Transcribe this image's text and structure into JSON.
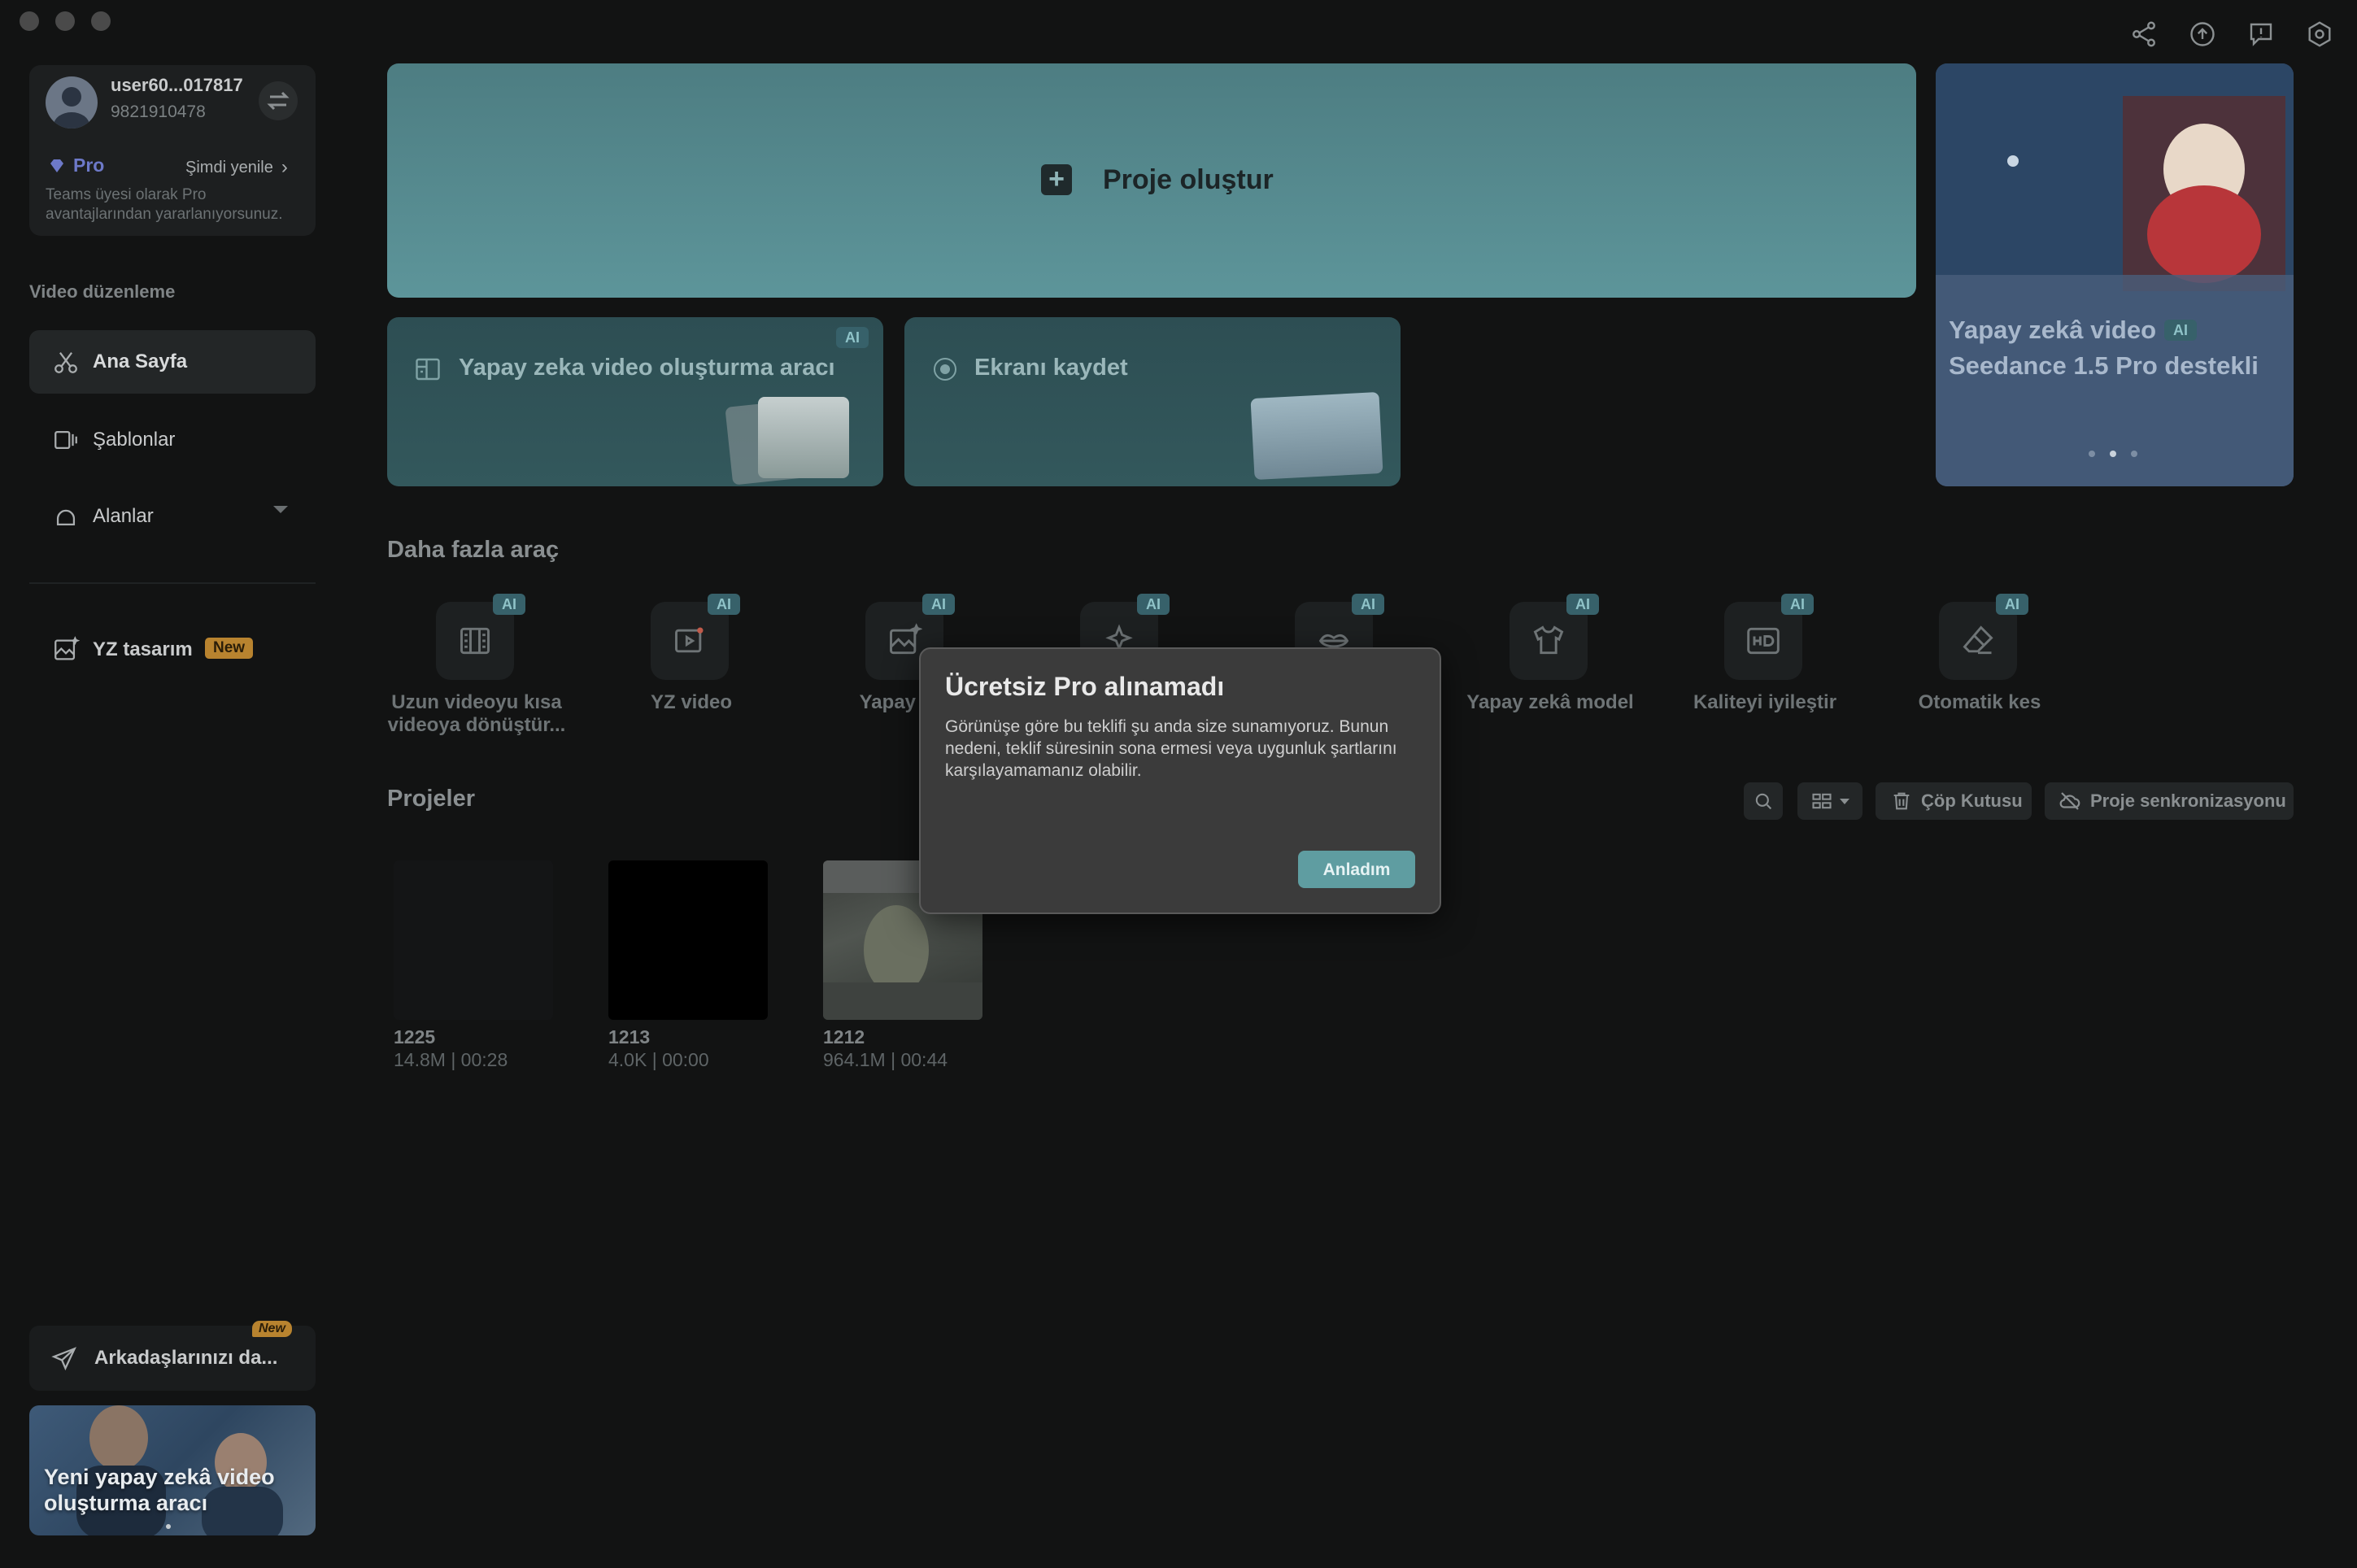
{
  "window": {
    "title": ""
  },
  "account": {
    "username": "user60...017817",
    "user_id": "9821910478",
    "plan": "Pro",
    "renew_label": "Şimdi yenile",
    "plan_description": "Teams üyesi olarak Pro avantajlarından yararlanıyorsunuz."
  },
  "sidebar": {
    "section_title": "Video düzenleme",
    "items": [
      {
        "label": "Ana Sayfa",
        "icon": "scissors-icon",
        "active": true
      },
      {
        "label": "Şablonlar",
        "icon": "template-icon"
      },
      {
        "label": "Alanlar",
        "icon": "cloud-icon"
      }
    ],
    "yz_item": {
      "label": "YZ tasarım",
      "badge": "New"
    },
    "invite": {
      "label": "Arkadaşlarınızı da...",
      "badge": "New"
    },
    "promo": {
      "text": "Yeni yapay zekâ video oluşturma aracı"
    }
  },
  "main": {
    "create_project_label": "Proje oluştur",
    "tool_cards": [
      {
        "label": "Yapay zeka video oluşturma aracı",
        "badge": "AI"
      },
      {
        "label": "Ekranı kaydet"
      }
    ],
    "banner": {
      "line1": "Yapay zekâ video",
      "badge": "AI",
      "line2": "Seedance 1.5 Pro destekli"
    },
    "more_tools_title": "Daha fazla araç",
    "tools": [
      {
        "label": "Uzun videoyu kısa videoya dönüştür...",
        "badge": "AI",
        "icon": "film-split-icon"
      },
      {
        "label": "YZ video",
        "badge": "AI",
        "icon": "video-ai-icon"
      },
      {
        "label": "Yapay zek",
        "badge": "AI",
        "icon": "image-ai-icon"
      },
      {
        "label": "",
        "badge": "AI",
        "icon": "sparkle-icon"
      },
      {
        "label": "",
        "badge": "AI",
        "icon": "lips-icon"
      },
      {
        "label": "Yapay zekâ model",
        "badge": "AI",
        "icon": "shirt-icon"
      },
      {
        "label": "Kaliteyi iyileştir",
        "badge": "AI",
        "icon": "hd-icon"
      },
      {
        "label": "Otomatik kes",
        "badge": "AI",
        "icon": "eraser-icon"
      }
    ],
    "projects_title": "Projeler",
    "trash_label": "Çöp Kutusu",
    "sync_label": "Proje senkronizasyonu",
    "projects": [
      {
        "name": "1225",
        "meta": "14.8M | 00:28"
      },
      {
        "name": "1213",
        "meta": "4.0K | 00:00"
      },
      {
        "name": "1212",
        "meta": "964.1M | 00:44"
      }
    ]
  },
  "dialog": {
    "title": "Ücretsiz Pro alınamadı",
    "message": "Görünüşe göre bu teklifi şu anda size sunamıyoruz. Bunun nedeni, teklif süresinin sona ermesi veya uygunluk şartlarını karşılayamamanız olabilir.",
    "confirm_label": "Anladım"
  },
  "colors": {
    "accent": "#5f9da1",
    "badge_new": "#e8a33c",
    "background": "#121313"
  }
}
